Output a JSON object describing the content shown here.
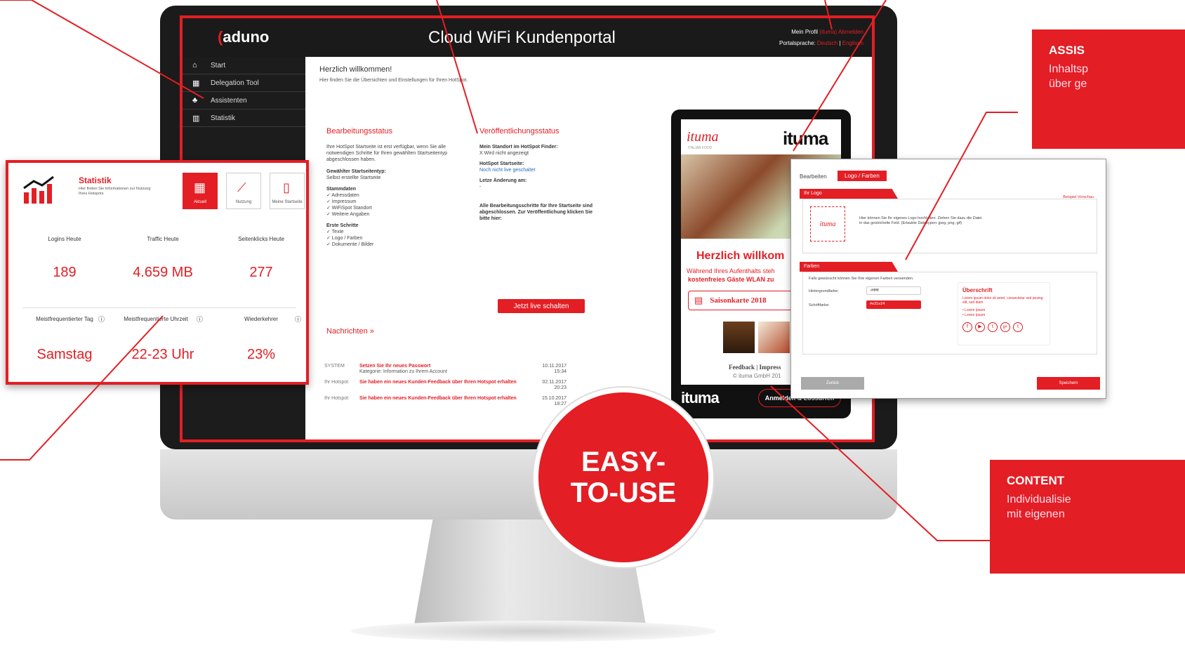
{
  "portal": {
    "logo": "aduno",
    "title": "Cloud WiFi Kundenportal",
    "profile_label": "Mein Profil",
    "profile_user": "(ituma)",
    "logout": "Abmelden",
    "language_label": "Portalsprache:",
    "lang_de": "Deutsch",
    "lang_en": "Englisch"
  },
  "sidebar": {
    "items": [
      {
        "label": "Start",
        "icon": "home-icon"
      },
      {
        "label": "Delegation Tool",
        "icon": "grid-icon"
      },
      {
        "label": "Assistenten",
        "icon": "people-icon"
      },
      {
        "label": "Statistik",
        "icon": "chart-icon"
      }
    ]
  },
  "main": {
    "welcome": "Herzlich willkommen!",
    "intro": "Hier finden Sie die Übersichten und Einstellungen für Ihren HotSpot.",
    "edit_status": {
      "title": "Bearbeitungsstatus",
      "text": "Ihre HotSpot Startseite ist erst verfügbar, wenn Sie alle notwendigen Schritte für Ihren gewählten Startseitentyp abgeschlossen haben.",
      "type_label": "Gewählter Startseitentyp:",
      "type_value": "Selbst erstellte Startseite",
      "master_label": "Stammdaten",
      "master_items": [
        "✓  Adressdaten",
        "✓  Impressum",
        "✓  WiFiSpot Standort",
        "✓  Weitere Angaben"
      ],
      "first_label": "Erste Schritte",
      "first_items": [
        "✓  Texte",
        "✓  Logo / Farben",
        "✓  Dokumente / Bilder"
      ]
    },
    "publish_status": {
      "title": "Veröffentlichungsstatus",
      "finder_label": "Mein Standort im HotSpot Finder:",
      "finder_value": "X  Wird nicht angezeigt",
      "start_label": "HotSpot Startseite:",
      "start_value": "Noch nicht live geschaltet",
      "change_label": "Letze Änderung am:",
      "change_value": "-",
      "done_text": "Alle Bearbeitungsschritte für Ihre Startseite sind abgeschlossen. Zur Veröffentlichung klicken Sie bitte hier:",
      "live_button": "Jetzt live schalten"
    },
    "news": {
      "title": "Nachrichten »",
      "rows": [
        {
          "source": "SYSTEM",
          "subject": "Setzen Sie Ihr neues Passwort",
          "detail": "Kategorie: Information zu Ihrem Account",
          "date": "10.11.2017",
          "time": "15:34"
        },
        {
          "source": "Ihr Hotspot",
          "subject": "Sie haben ein neues Kunden-Feedback über Ihren Hotspot erhalten",
          "detail": "",
          "date": "02.11.2017",
          "time": "20:23"
        },
        {
          "source": "Ihr Hotspot",
          "subject": "Sie haben ein neues Kunden-Feedback über Ihren Hotspot erhalten",
          "detail": "",
          "date": "15.10.2017",
          "time": "18:27"
        }
      ]
    }
  },
  "stats": {
    "title": "Statistik",
    "subtitle": "Hier finden Sie Informationen zur Nutzung Ihres Hotspots",
    "buttons": [
      "Aktuell",
      "Nutzung",
      "Meine Startseite"
    ],
    "labels": [
      "Logins Heute",
      "Traffic Heute",
      "Seitenklicks Heute",
      "Meistfrequentierter Tag",
      "Meistfrequentierte Uhrzeit",
      "Wiederkehrer"
    ],
    "values": [
      "189",
      "4.659 MB",
      "277",
      "Samstag",
      "22-23 Uhr",
      "23%"
    ]
  },
  "tablet": {
    "brand_script": "ituma",
    "brand_script_sub": "ITALIAN FOOD",
    "brand": "ituma",
    "headline": "Herzlich willkom",
    "line1": "Während Ihres Aufenthalts steh",
    "line2": "kostenfreies Gäste WLAN zu",
    "season": "Saisonkarte 2018",
    "feedback": "Feedback | Impress",
    "copyright": "© ituma GmbH 201",
    "footer_brand": "ituma",
    "login": "Anmelden & Lossurfen"
  },
  "assistant": {
    "tabs": [
      "Bearbeiten",
      "Logo / Farben"
    ],
    "logo_section": "Ihr Logo",
    "logo_preview": "ituma",
    "preview_link": "Beispiel Vorschau",
    "logo_hint": "Hier können Sie Ihr eigenes Logo hochladen. Ziehen Sie dazu die Datei in das gestrichelte Feld. (Erlaubte Dateitypen: jpeg, png, gif)",
    "colors_section": "Farben",
    "colors_hint": "Falls gewünscht können Sie Ihre eigenen Farben verwenden.",
    "bg_label": "Hintergrundfarbe:",
    "bg_value": "#ffffff",
    "font_label": "Schriftfarbe:",
    "font_value": "#e31e24",
    "preview_title": "Überschrift",
    "preview_text": "Lorem ipsum dolor sit amet, consectetur sed posing elit, sed diam",
    "preview_bullets": [
      "• Lorem Ipsum",
      "• Lorem Ipsum"
    ],
    "back_button": "Zurück",
    "save_button": "Speichern"
  },
  "callouts": {
    "assist_title": "ASSIS",
    "assist_line1": "Inhaltsp",
    "assist_line2": "über ge",
    "content_title": "CONTENT",
    "content_line1": "Individualisie",
    "content_line2": "mit eigenen"
  },
  "badge": {
    "line1": "EASY-",
    "line2": "TO-USE"
  },
  "colors": {
    "accent": "#e31e24",
    "dark": "#1a1a1a"
  }
}
